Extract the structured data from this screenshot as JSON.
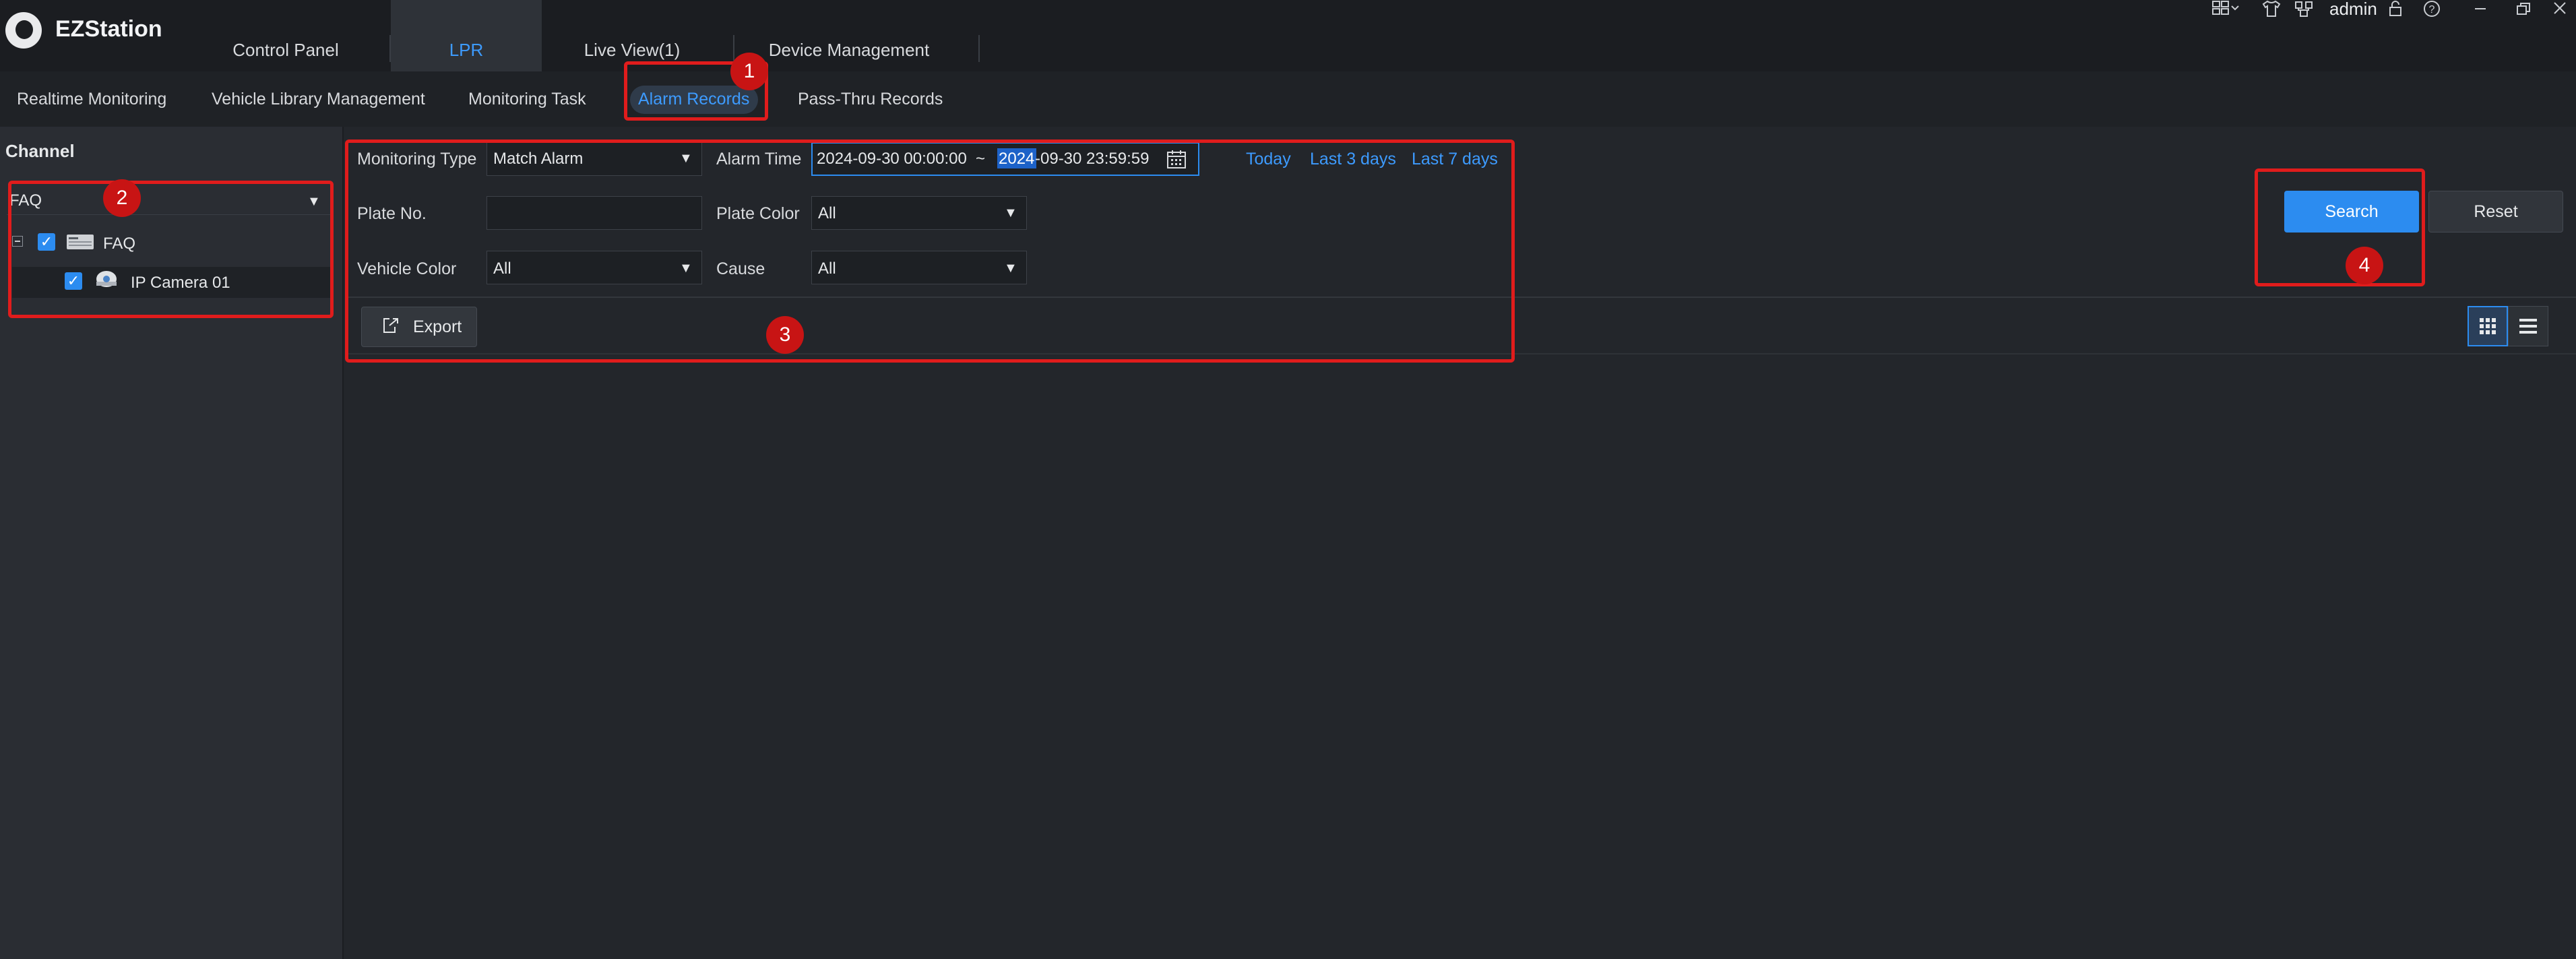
{
  "app": {
    "title": "EZStation"
  },
  "main_tabs": [
    {
      "label": "Control Panel"
    },
    {
      "label": "LPR"
    },
    {
      "label": "Live View(1)"
    },
    {
      "label": "Device Management"
    }
  ],
  "user": {
    "name": "admin"
  },
  "sub_tabs": [
    {
      "label": "Realtime Monitoring"
    },
    {
      "label": "Vehicle Library Management"
    },
    {
      "label": "Monitoring Task"
    },
    {
      "label": "Alarm Records"
    },
    {
      "label": "Pass-Thru Records"
    }
  ],
  "channel": {
    "title": "Channel",
    "select_value": "FAQ",
    "tree": [
      {
        "label": "FAQ"
      },
      {
        "label": "IP Camera 01"
      }
    ]
  },
  "filters": {
    "monitoring_type": {
      "label": "Monitoring Type",
      "value": "Match Alarm"
    },
    "alarm_time": {
      "label": "Alarm Time",
      "start": "2024-09-30 00:00:00",
      "separator": "~",
      "end_highlight": "2024",
      "end_rest": "-09-30 23:59:59"
    },
    "quick_ranges": [
      "Today",
      "Last 3 days",
      "Last 7 days"
    ],
    "plate_no": {
      "label": "Plate No.",
      "value": ""
    },
    "plate_color": {
      "label": "Plate Color",
      "value": "All"
    },
    "vehicle_color": {
      "label": "Vehicle Color",
      "value": "All"
    },
    "cause": {
      "label": "Cause",
      "value": "All"
    }
  },
  "actions": {
    "export": "Export",
    "search": "Search",
    "reset": "Reset"
  },
  "annotations": [
    "1",
    "2",
    "3",
    "4"
  ],
  "colors": {
    "accent": "#2c8cf0",
    "annotation": "#e01c1c",
    "background": "#23262b"
  }
}
